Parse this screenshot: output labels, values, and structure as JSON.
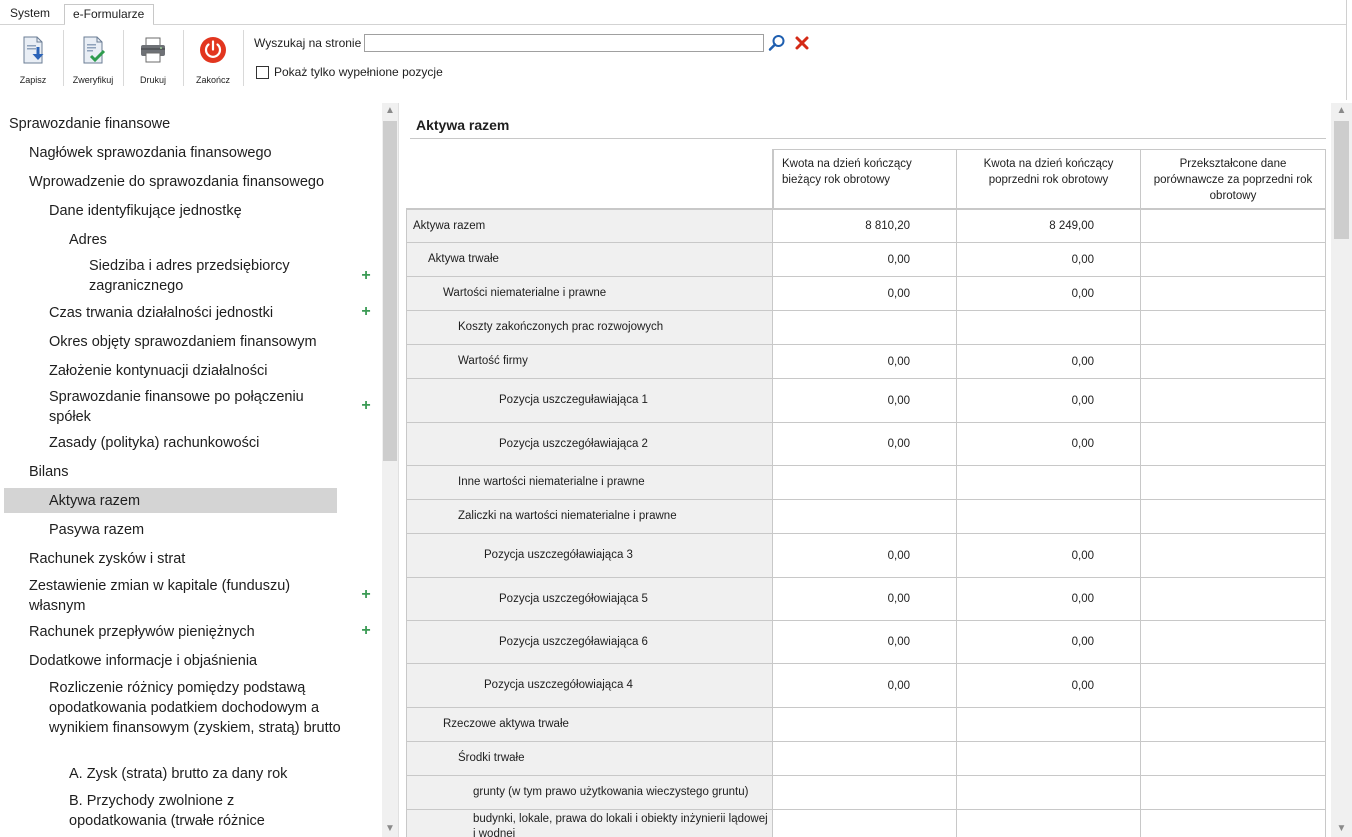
{
  "tabs": {
    "system": "System",
    "eforms": "e-Formularze"
  },
  "toolbar": {
    "save": "Zapisz",
    "verify": "Zweryfikuj",
    "print": "Drukuj",
    "finish": "Zakończ",
    "search_label": "Wyszukaj na stronie",
    "search_value": "",
    "filled_only": "Pokaż tylko wypełnione pozycje"
  },
  "tree": [
    {
      "label": "Sprawozdanie finansowe"
    },
    {
      "label": "Nagłówek sprawozdania finansowego"
    },
    {
      "label": "Wprowadzenie do sprawozdania finansowego"
    },
    {
      "label": "Dane identyfikujące jednostkę"
    },
    {
      "label": "Adres"
    },
    {
      "label": "Siedziba i adres przedsiębiorcy zagranicznego"
    },
    {
      "label": "Czas trwania działalności jednostki"
    },
    {
      "label": "Okres objęty sprawozdaniem finansowym"
    },
    {
      "label": "Założenie kontynuacji działalności"
    },
    {
      "label": "Sprawozdanie finansowe po połączeniu spółek"
    },
    {
      "label": "Zasady (polityka) rachunkowości"
    },
    {
      "label": "Bilans"
    },
    {
      "label": "Aktywa razem"
    },
    {
      "label": "Pasywa razem"
    },
    {
      "label": "Rachunek zysków i strat"
    },
    {
      "label": "Zestawienie zmian w kapitale (funduszu) własnym"
    },
    {
      "label": "Rachunek przepływów pieniężnych"
    },
    {
      "label": "Dodatkowe informacje i objaśnienia"
    },
    {
      "label": "Rozliczenie różnicy pomiędzy podstawą opodatkowania podatkiem dochodowym a wynikiem finansowym (zyskiem, stratą) brutto"
    },
    {
      "label": "A. Zysk (strata) brutto za dany rok"
    },
    {
      "label": "B. Przychody zwolnione z opodatkowania (trwałe różnice"
    }
  ],
  "content": {
    "title": "Aktywa razem",
    "columns": [
      "Kwota na dzień kończący bieżący rok obrotowy",
      "Kwota na dzień kończący poprzedni rok obrotowy",
      "Przekształcone dane porównawcze za poprzedni rok obrotowy"
    ],
    "rows": [
      {
        "label": "Aktywa razem",
        "v1": "8 810,20",
        "v2": "8 249,00",
        "v3": ""
      },
      {
        "label": "Aktywa trwałe",
        "v1": "0,00",
        "v2": "0,00",
        "v3": ""
      },
      {
        "label": "Wartości niematerialne i prawne",
        "v1": "0,00",
        "v2": "0,00",
        "v3": ""
      },
      {
        "label": "Koszty zakończonych prac rozwojowych",
        "v1": "",
        "v2": "",
        "v3": ""
      },
      {
        "label": "Wartość firmy",
        "v1": "0,00",
        "v2": "0,00",
        "v3": ""
      },
      {
        "label": "Pozycja uszczeguławiająca 1",
        "v1": "0,00",
        "v2": "0,00",
        "v3": ""
      },
      {
        "label": "Pozycja uszczegóławiająca 2",
        "v1": "0,00",
        "v2": "0,00",
        "v3": ""
      },
      {
        "label": "Inne wartości niematerialne i prawne",
        "v1": "",
        "v2": "",
        "v3": ""
      },
      {
        "label": "Zaliczki na wartości niematerialne i prawne",
        "v1": "",
        "v2": "",
        "v3": ""
      },
      {
        "label": "Pozycja uszczegóławiająca 3",
        "v1": "0,00",
        "v2": "0,00",
        "v3": ""
      },
      {
        "label": "Pozycja uszczegółowiająca 5",
        "v1": "0,00",
        "v2": "0,00",
        "v3": ""
      },
      {
        "label": "Pozycja uszczegóławiająca 6",
        "v1": "0,00",
        "v2": "0,00",
        "v3": ""
      },
      {
        "label": "Pozycja uszczegółowiająca 4",
        "v1": "0,00",
        "v2": "0,00",
        "v3": ""
      },
      {
        "label": "Rzeczowe aktywa trwałe",
        "v1": "",
        "v2": "",
        "v3": ""
      },
      {
        "label": "Środki trwałe",
        "v1": "",
        "v2": "",
        "v3": ""
      },
      {
        "label": "grunty (w tym prawo użytkowania wieczystego gruntu)",
        "v1": "",
        "v2": "",
        "v3": ""
      },
      {
        "label": "budynki, lokale, prawa do lokali i obiekty inżynierii lądowej i wodnej",
        "v1": "",
        "v2": "",
        "v3": ""
      }
    ]
  }
}
